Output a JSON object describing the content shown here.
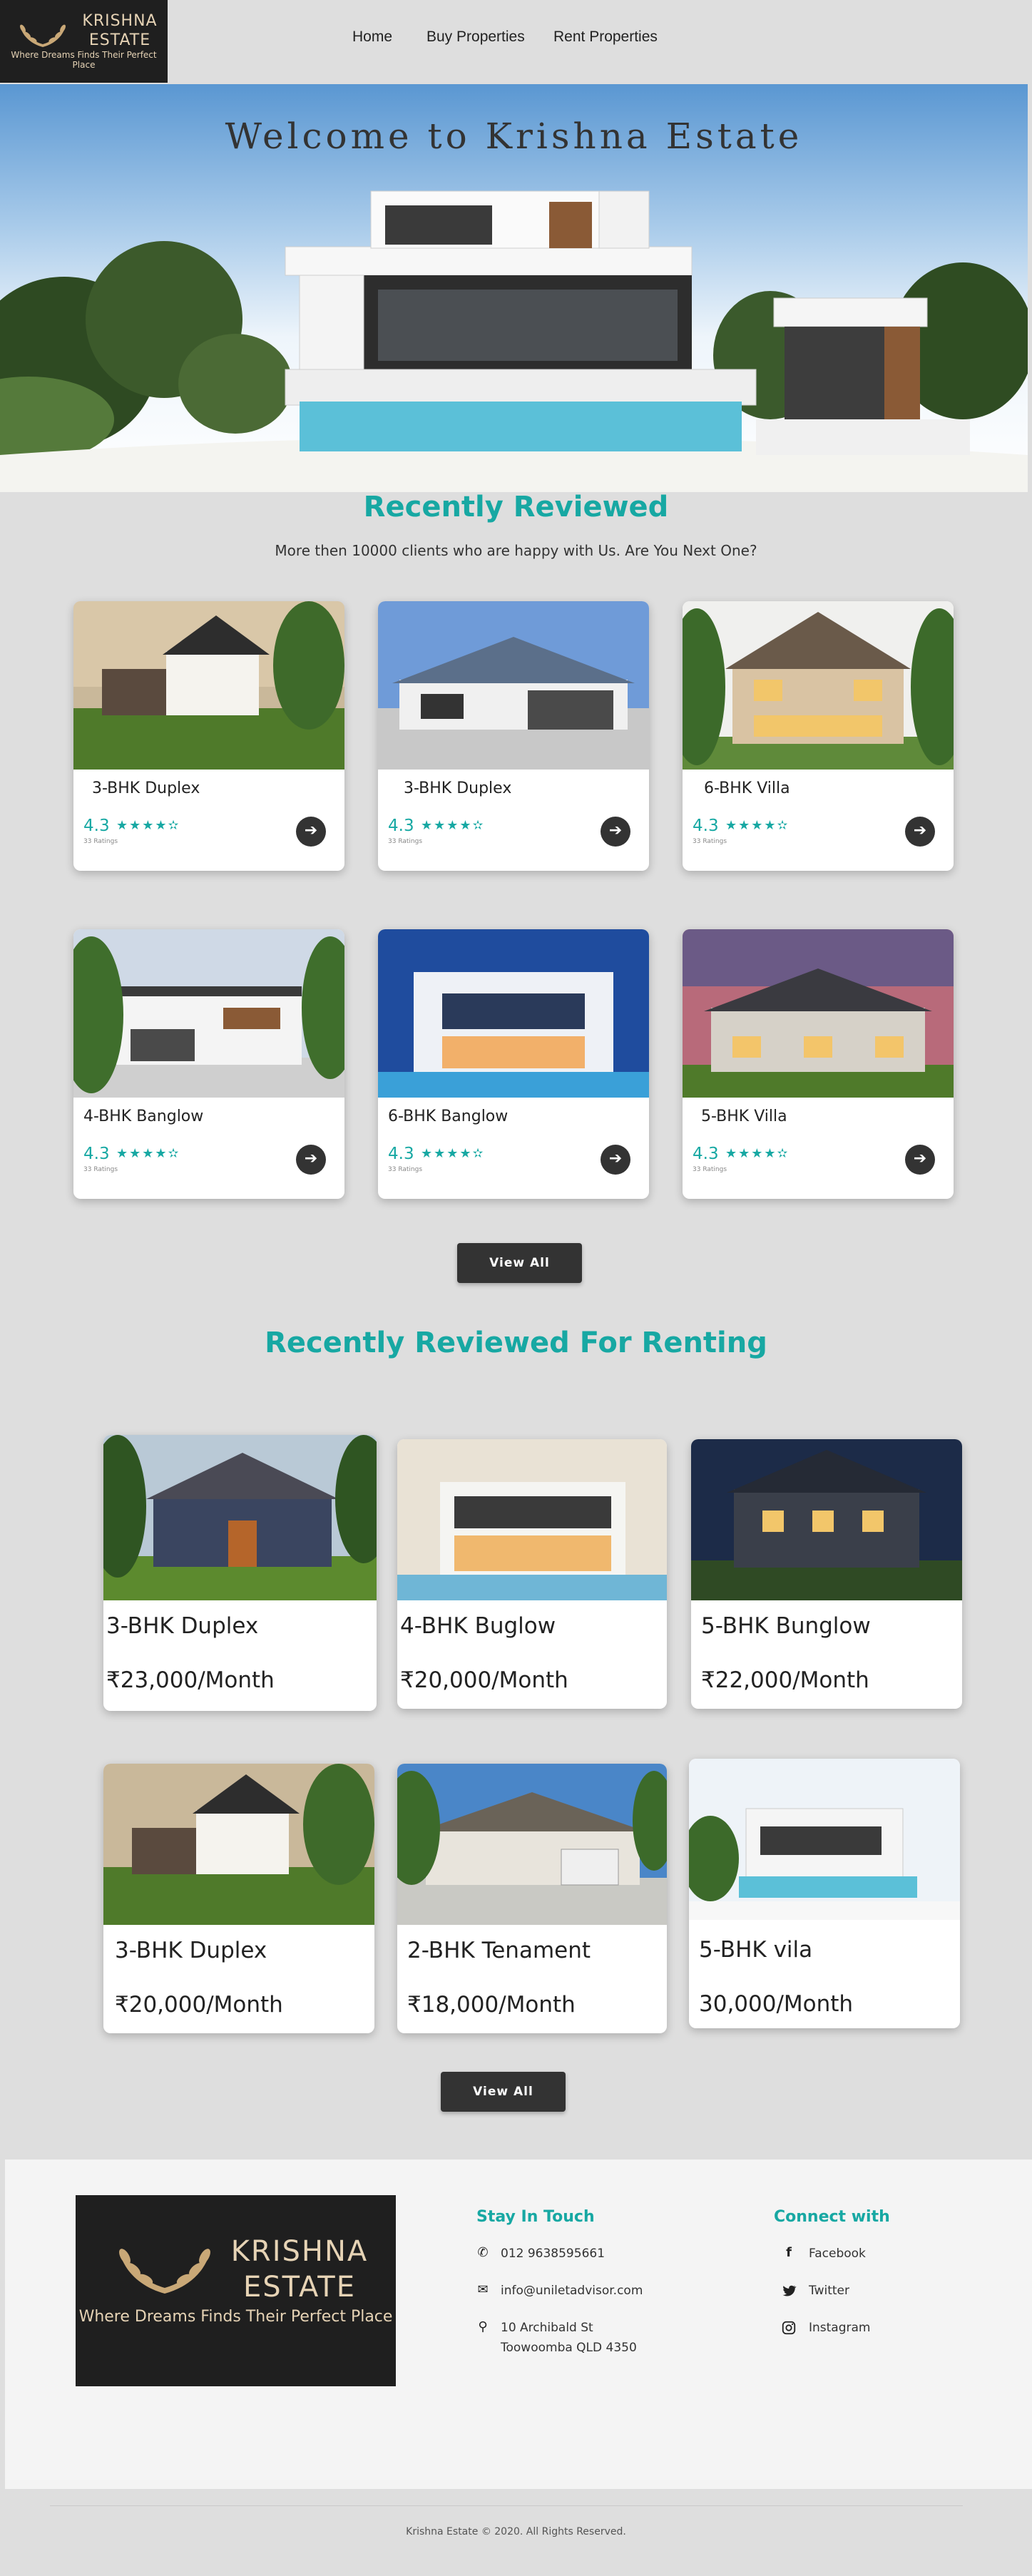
{
  "header": {
    "brand_line1": "KRISHNA",
    "brand_line2": "ESTATE",
    "tagline": "Where Dreams Finds Their Perfect Place",
    "nav": [
      "Home",
      "Buy Properties",
      "Rent Properties"
    ]
  },
  "hero": {
    "title": "Welcome to Krishna Estate"
  },
  "reviewed": {
    "title": "Recently Reviewed",
    "subtitle": "More then 10000 clients who are happy with Us. Are You Next One?",
    "cards": [
      {
        "title": "3-BHK Duplex",
        "rating": "4.3",
        "stars": "★★★★",
        "half": "✫",
        "count": "33 Ratings",
        "arrow": "➔"
      },
      {
        "title": "3-BHK Duplex",
        "rating": "4.3",
        "stars": "★★★★",
        "half": "✫",
        "count": "33 Ratings",
        "arrow": "➔"
      },
      {
        "title": "6-BHK Villa",
        "rating": "4.3",
        "stars": "★★★★",
        "half": "✫",
        "count": "33 Ratings",
        "arrow": "➔"
      },
      {
        "title": "4-BHK Banglow",
        "rating": "4.3",
        "stars": "★★★★",
        "half": "✫",
        "count": "33 Ratings",
        "arrow": "➔"
      },
      {
        "title": "6-BHK Banglow",
        "rating": "4.3",
        "stars": "★★★★",
        "half": "✫",
        "count": "33 Ratings",
        "arrow": "➔"
      },
      {
        "title": "5-BHK Villa",
        "rating": "4.3",
        "stars": "★★★★",
        "half": "✫",
        "count": "33 Ratings",
        "arrow": "➔"
      }
    ],
    "view_all": "View All"
  },
  "renting": {
    "title": "Recently Reviewed For Renting",
    "cards": [
      {
        "title": "3-BHK Duplex",
        "price": "₹23,000/Month"
      },
      {
        "title": "4-BHK Buglow",
        "price": "₹20,000/Month"
      },
      {
        "title": "5-BHK Bunglow",
        "price": "₹22,000/Month"
      },
      {
        "title": "3-BHK Duplex",
        "price": "₹20,000/Month"
      },
      {
        "title": "2-BHK Tenament",
        "price": "₹18,000/Month"
      },
      {
        "title": "5-BHK vila",
        "price": "30,000/Month"
      }
    ],
    "view_all": "View All"
  },
  "footer": {
    "brand_line1": "KRISHNA",
    "brand_line2": "ESTATE",
    "tagline": "Where Dreams Finds Their Perfect Place",
    "contact_heading": "Stay In Touch",
    "phone": "012 9638595661",
    "email": "info@uniletadvisor.com",
    "address_line1": "10 Archibald St",
    "address_line2": "Toowoomba QLD 4350",
    "social_heading": "Connect with",
    "social": [
      "Facebook",
      "Twitter",
      "Instagram"
    ],
    "copyright": "Krishna Estate © 2020. All Rights Reserved."
  },
  "colors": {
    "accent": "#17a8a3",
    "dark": "#333333",
    "logo_bg": "#1f1f1f",
    "logo_text": "#e6d3b5",
    "page_bg": "#dedede"
  }
}
